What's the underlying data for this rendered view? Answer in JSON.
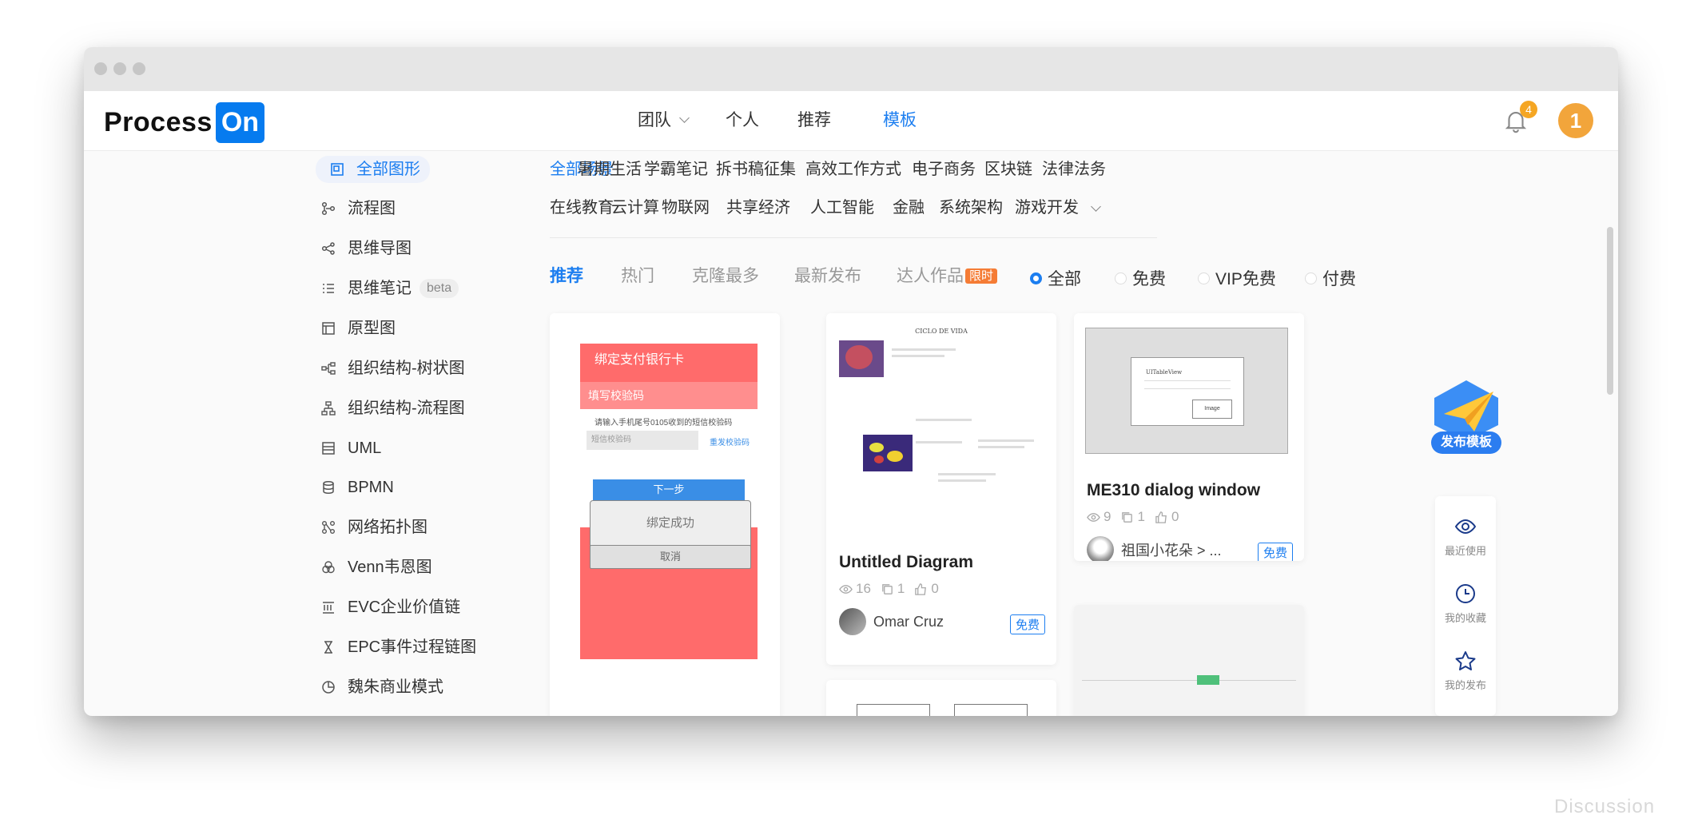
{
  "header": {
    "logo_text": "Process",
    "logo_badge": "On",
    "nav": [
      "团队",
      "个人",
      "推荐",
      "模板"
    ],
    "notification_count": "4",
    "user_avatar": "1"
  },
  "sidebar": {
    "items": [
      {
        "label": "全部图形",
        "icon": "shapes-icon"
      },
      {
        "label": "流程图",
        "icon": "flowchart-icon"
      },
      {
        "label": "思维导图",
        "icon": "mindmap-icon"
      },
      {
        "label": "思维笔记",
        "icon": "list-icon",
        "badge": "beta"
      },
      {
        "label": "原型图",
        "icon": "prototype-icon"
      },
      {
        "label": "组织结构-树状图",
        "icon": "org-tree-icon"
      },
      {
        "label": "组织结构-流程图",
        "icon": "org-flow-icon"
      },
      {
        "label": "UML",
        "icon": "uml-icon"
      },
      {
        "label": "BPMN",
        "icon": "bpmn-icon"
      },
      {
        "label": "网络拓扑图",
        "icon": "network-icon"
      },
      {
        "label": "Venn韦恩图",
        "icon": "venn-icon"
      },
      {
        "label": "EVC企业价值链",
        "icon": "evc-icon"
      },
      {
        "label": "EPC事件过程链图",
        "icon": "epc-icon"
      },
      {
        "label": "魏朱商业模式",
        "icon": "pie-icon"
      }
    ]
  },
  "categories": {
    "row1": [
      "全部场景",
      "暑期生活",
      "学霸笔记",
      "拆书稿征集",
      "高效工作方式",
      "电子商务",
      "区块链",
      "法律法务"
    ],
    "row2": [
      "在线教育",
      "云计算",
      "物联网",
      "共享经济",
      "人工智能",
      "金融",
      "系统架构",
      "游戏开发"
    ]
  },
  "filters": {
    "tabs": [
      "推荐",
      "热门",
      "克隆最多",
      "最新发布",
      "达人作品"
    ],
    "limited_badge": "限时",
    "price_options": [
      "全部",
      "免费",
      "VIP免费",
      "付费"
    ]
  },
  "cards": [
    {
      "thumb_text": {
        "header": "绑定支付银行卡",
        "section": "填写校验码",
        "hint": "请输入手机尾号0105收到的短信校验码",
        "input_placeholder": "短信校验码",
        "resend": "重发校验码",
        "next": "下一步",
        "dialog": "绑定成功",
        "cancel": "取消"
      }
    },
    {
      "title": "Untitled Diagram",
      "views": "16",
      "clones": "1",
      "likes": "0",
      "author": "Omar Cruz",
      "price_tag": "免费",
      "thumb_title": "CICLO DE VIDA"
    },
    {
      "title": "ME310 dialog window",
      "views": "9",
      "clones": "1",
      "likes": "0",
      "author": "祖国小花朵 > ...",
      "price_tag": "免费",
      "thumb_window_title": "UITableView",
      "thumb_button": "Image"
    }
  ],
  "publish_button": "发布模板",
  "right_toolbar": [
    "最近使用",
    "我的收藏",
    "我的发布"
  ],
  "watermark": "Discussion",
  "colors": {
    "accent": "#1c7ef0",
    "brand": "#067bef",
    "avatar": "#f2a53b",
    "limited": "#f57c35"
  }
}
